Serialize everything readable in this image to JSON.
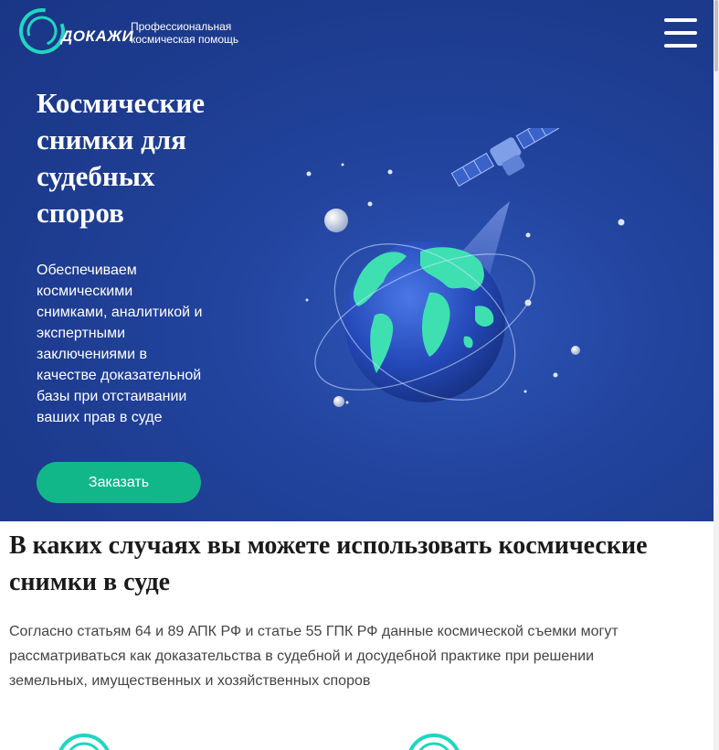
{
  "header": {
    "logo_text": "ДОКАЖИ",
    "tagline_line1": "Профессиональная",
    "tagline_line2": "космическая помощь",
    "menu_icon": "hamburger-menu-icon"
  },
  "hero": {
    "title_lines": [
      "Космические",
      "снимки для",
      "судебных",
      "споров"
    ],
    "text_lines": [
      "Обеспечиваем",
      "космическими",
      "снимками, аналитикой и",
      "экспертными",
      "заключениями в",
      "качестве доказательной",
      "базы при отстаивании",
      "ваших прав в суде"
    ],
    "order_button": "Заказать",
    "illustration": "satellite-earth-illustration"
  },
  "cases": {
    "title_line1": "В каких случаях вы можете использовать космические",
    "title_line2": "снимки в суде",
    "text_line1": "Согласно статьям 64 и 89 АПК РФ и статье 55 ГПК РФ данные космической съемки могут",
    "text_line2": "рассматриваться как доказательства в судебной и досудебной практике при решении",
    "text_line3": "земельных, имущественных и хозяйственных споров"
  },
  "colors": {
    "hero_bg": "#1f3f93",
    "accent_green": "#12b789",
    "logo_ring": "#1fd6c0"
  }
}
